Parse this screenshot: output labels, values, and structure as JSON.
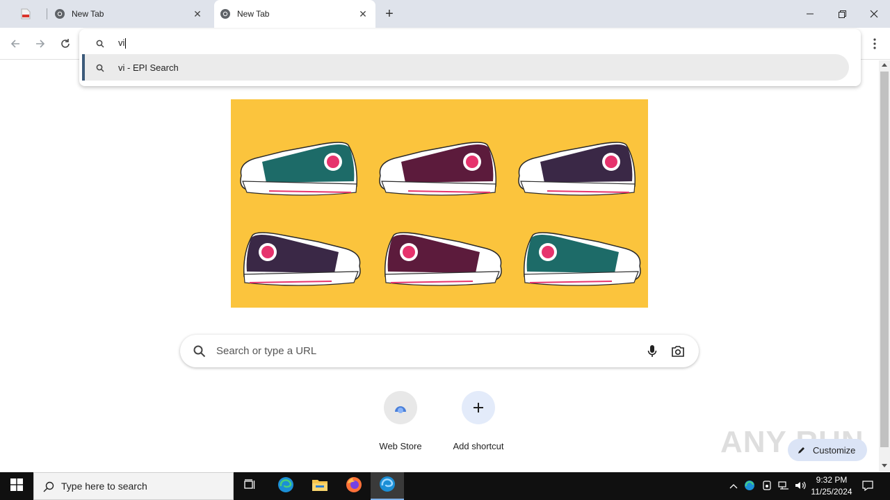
{
  "tabs": [
    {
      "title": ""
    },
    {
      "title": "New Tab"
    },
    {
      "title": "New Tab"
    }
  ],
  "omnibox": {
    "input_value": "vi",
    "suggestion": "vi - EPI Search"
  },
  "search": {
    "placeholder": "Search or type a URL"
  },
  "shortcuts": [
    {
      "label": "Web Store"
    },
    {
      "label": "Add shortcut"
    }
  ],
  "customize_label": "Customize",
  "watermark": "ANY RUN",
  "taskbar": {
    "search_placeholder": "Type here to search",
    "time": "9:32 PM",
    "date": "11/25/2024"
  },
  "colors": {
    "doodle_background": "#fbc43d",
    "tabstrip": "#dfe3eb",
    "taskbar": "#101010"
  }
}
